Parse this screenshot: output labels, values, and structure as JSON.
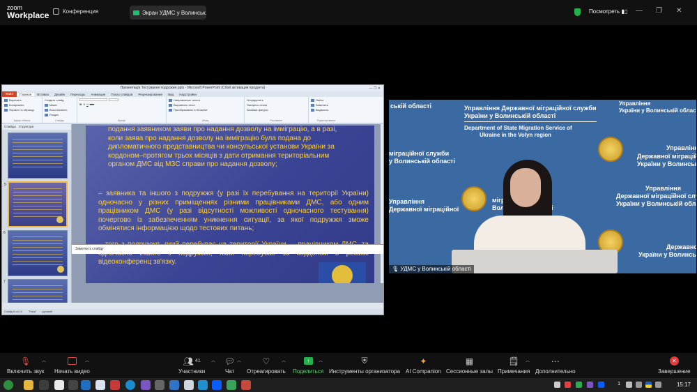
{
  "topbar": {
    "logo_line1": "zoom",
    "logo_line2": "Workplace",
    "conference_label": "Конференция",
    "share_tab": "Экран УДМС у Волинськ...",
    "view_label": "Посмотреть",
    "colors": {
      "secure": "#22b14c",
      "share_tab_icon": "#1dbf73"
    }
  },
  "ppt": {
    "title": "Презентація Тестування подружжя.pptx  -  Microsoft PowerPoint (Сбой активации продукта)",
    "tabs": [
      "Файл",
      "Главная",
      "Вставка",
      "Дизайн",
      "Переходы",
      "Анимация",
      "Показ слайдов",
      "Рецензирование",
      "Вид",
      "Надстройки"
    ],
    "ribbon": {
      "clipboard": [
        "Вырезать",
        "Копировать",
        "Формат по образцу"
      ],
      "clipboard_label": "Буфер обмена",
      "insert": "Вставить",
      "create_slide": "Создать слайд",
      "slides": [
        "Макет",
        "Восстановить",
        "Раздел"
      ],
      "slides_label": "Слайды",
      "font_label": "Шрифт",
      "paragraph": [
        "Направление текста",
        "Выровнять текст",
        "Преобразовать в SmartArt"
      ],
      "paragraph_label": "Абзац",
      "arrange": "Упорядочить",
      "quick_styles": "Экспресс-стили",
      "drawing": [
        "Заливка фигуры",
        "Контур фигуры",
        "Эффекты фигур"
      ],
      "drawing_label": "Рисование",
      "editing": [
        "Найти",
        "Заменить",
        "Выделить"
      ],
      "editing_label": "Редактирование"
    },
    "thumb_tabs": [
      "Слайды",
      "Структура"
    ],
    "thumb_numbers": [
      "",
      "5",
      "6",
      "7"
    ],
    "slide_paragraphs": [
      "подання заявником заяви про надання дозволу на імміграцію, а в разі, коли заява про надання дозволу на імміграцію була подана до дипломатичного представництва чи консульської установи України за кордоном–протягом трьох місяців з дати отримання територіальним органом ДМС від МЗС справи про надання дозволу;",
      "– заявника та іншого з подружжя (у разі їх перебування на території України) одночасно у різних приміщеннях різними працівниками ДМС, або одним працівником ДМС (у разі відсутності можливості одночасного тестування) почергово із забезпеченням уникнення ситуації, за якої подружжя зможе обмінятися інформацією щодо тестових питань;",
      "– того з подружжя, який перебуває на території України, – працівником ДМС, та одночасно іншого з подружжя, який перебуває за кордоном в режимі відеоконференц зв'язку."
    ],
    "notes_placeholder": "Заметки к слайду",
    "status": [
      "Слайд 6 из 10",
      "\"Тема\"",
      "русский"
    ],
    "colors": {
      "slide_text": "#ffd23a",
      "slide_bg": "#3b4494",
      "file_tab": "#d24625"
    }
  },
  "video": {
    "participant_name": "УДМС у Волинській області",
    "backdrop_texts": [
      "Управління Державної міграційної служби",
      "України у Волинській області",
      "Department of State Migration Service of",
      "Ukraine in the Volyn region",
      "ській області",
      "Управління",
      "Державної міграційної",
      "України у Волинській області",
      "міграційної служби",
      "у Волинській області",
      "Управління",
      "Державної міграційної служби",
      "України у Волинській області",
      "міграційної служби",
      "Волинській області",
      "Управління",
      "Державної міграційної служби",
      "України у Волинській області",
      "Управління",
      "Державної міграційної",
      "України у Волинській області"
    ],
    "colors": {
      "backdrop": "#3b6aa3"
    }
  },
  "toolbar": {
    "items": [
      {
        "label": "Включить звук",
        "icon": "mic-muted-icon"
      },
      {
        "label": "Начать видео",
        "icon": "video-off-icon"
      },
      {
        "label": "Участники",
        "icon": "participants-icon",
        "count": "41"
      },
      {
        "label": "Чат",
        "icon": "chat-icon"
      },
      {
        "label": "Отреагировать",
        "icon": "heart-icon"
      },
      {
        "label": "Поделиться",
        "icon": "share-icon"
      },
      {
        "label": "Инструменты организатора",
        "icon": "shield-icon"
      },
      {
        "label": "AI Companion",
        "icon": "sparkle-icon"
      },
      {
        "label": "Сессионные залы",
        "icon": "grid-icon"
      },
      {
        "label": "Примечания",
        "icon": "notes-icon"
      },
      {
        "label": "Дополнительно",
        "icon": "more-icon"
      },
      {
        "label": "Завершение",
        "icon": "end-icon"
      }
    ],
    "colors": {
      "share": "#22b14c",
      "end": "#e23b3b",
      "muted": "#e04b4b"
    }
  },
  "taskbar": {
    "clock": "15:17",
    "tray_text": "1"
  }
}
